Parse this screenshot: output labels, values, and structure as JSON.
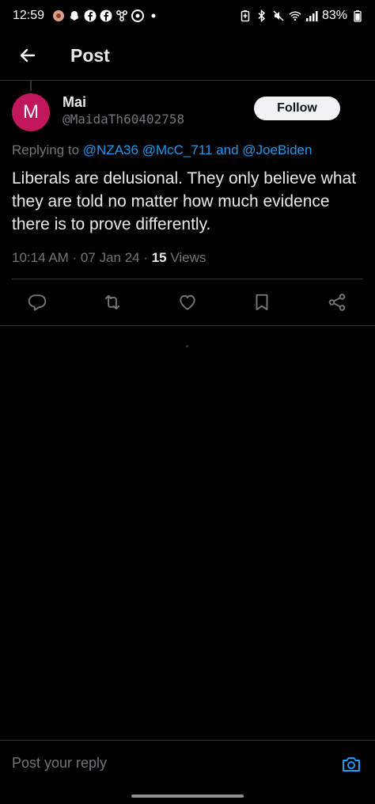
{
  "status_bar": {
    "time": "12:59",
    "battery": "83%",
    "left_icons": [
      "app-icon",
      "snapchat-icon",
      "facebook-icon",
      "facebook-icon",
      "network-icon",
      "chrome-icon",
      "dot-icon"
    ],
    "right_icons": [
      "battery-saver-icon",
      "bluetooth-icon",
      "mute-icon",
      "wifi-icon",
      "signal-icon"
    ]
  },
  "header": {
    "title": "Post"
  },
  "tweet": {
    "avatar_letter": "M",
    "author_name": "Mai",
    "author_handle": "@MaidaTh60402758",
    "follow_label": "Follow",
    "replying_prefix": "Replying to ",
    "mention_1": "@NZA36",
    "mention_2": "@McC_711",
    "mention_and": "and",
    "mention_3": "@JoeBiden",
    "text": "Liberals are delusional.  They only believe what they are told no matter how much evidence there is to prove differently.",
    "timestamp": "10:14 AM · 07 Jan 24 · ",
    "views_count": "15",
    "views_label": " Views"
  },
  "reply": {
    "placeholder": "Post your reply"
  },
  "colors": {
    "background": "#000000",
    "accent": "#1d9bf0",
    "avatar": "#c2185b",
    "muted": "#71767b"
  }
}
